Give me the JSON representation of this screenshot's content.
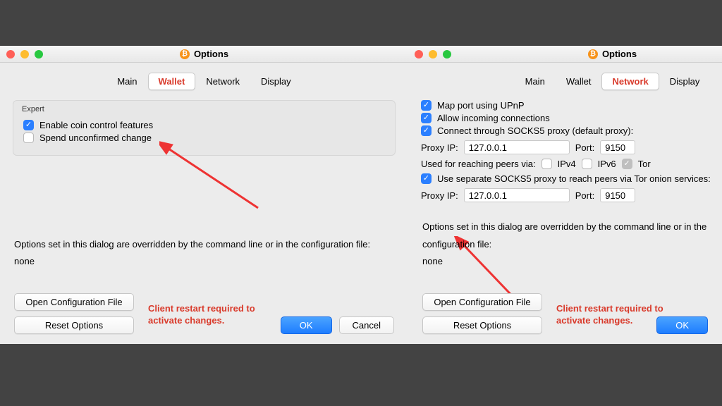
{
  "window": {
    "title": "Options"
  },
  "tabs": {
    "main": "Main",
    "wallet": "Wallet",
    "network": "Network",
    "display": "Display"
  },
  "left": {
    "group_label": "Expert",
    "coin_control": "Enable coin control features",
    "spend_unconf": "Spend unconfirmed change"
  },
  "right": {
    "upnp": "Map port using UPnP",
    "allow_incoming": "Allow incoming connections",
    "socks5": "Connect through SOCKS5 proxy (default proxy):",
    "proxy_ip_label": "Proxy IP:",
    "proxy_ip": "127.0.0.1",
    "port_label": "Port:",
    "port": "9150",
    "reach_label": "Used for reaching peers via:",
    "ipv4": "IPv4",
    "ipv6": "IPv6",
    "tor": "Tor",
    "sep_socks5": "Use separate SOCKS5 proxy to reach peers via Tor onion services:",
    "proxy2_ip": "127.0.0.1",
    "port2": "9150"
  },
  "override_text": "Options set in this dialog are overridden by the command line or in the configuration file:",
  "override_value": "none",
  "buttons": {
    "open_conf": "Open Configuration File",
    "reset": "Reset Options",
    "ok": "OK",
    "cancel": "Cancel"
  },
  "restart_msg": "Client restart required to activate changes."
}
